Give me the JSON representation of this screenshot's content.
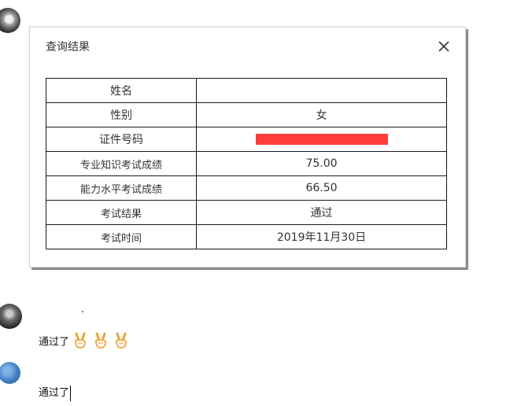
{
  "dialog": {
    "title": "查询结果",
    "close_icon": "close-icon"
  },
  "result_table": {
    "rows": [
      {
        "label": "姓名",
        "value": ""
      },
      {
        "label": "性别",
        "value": "女"
      },
      {
        "label": "证件号码",
        "value": "",
        "redacted": true
      },
      {
        "label": "专业知识考试成绩",
        "value": "75.00"
      },
      {
        "label": "能力水平考试成绩",
        "value": "66.50"
      },
      {
        "label": "考试结果",
        "value": "通过"
      },
      {
        "label": "考试时间",
        "value": "2019年11月30日"
      }
    ]
  },
  "chat": {
    "messages": [
      {
        "text": "通过了",
        "emoji": [
          "victory-hand-icon",
          "victory-hand-icon",
          "victory-hand-icon"
        ]
      },
      {
        "text": "通过了"
      }
    ]
  },
  "colors": {
    "redaction": "#ff3c3c",
    "emoji": "#f0a43a"
  }
}
